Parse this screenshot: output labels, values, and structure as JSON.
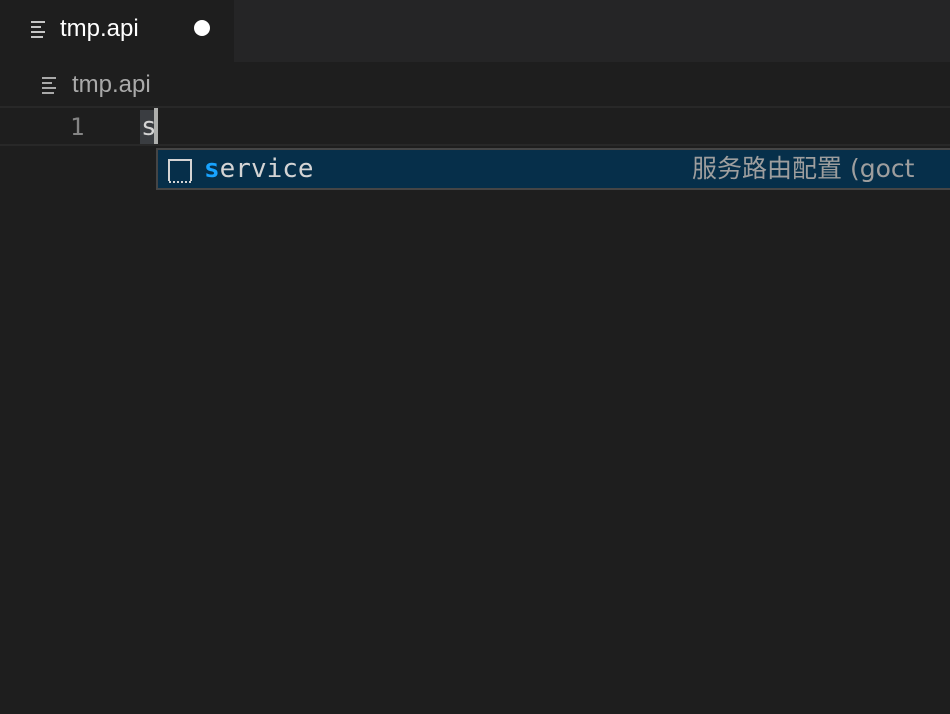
{
  "tab": {
    "title": "tmp.api",
    "icon": "lines-icon",
    "dirty": true
  },
  "breadcrumb": {
    "label": "tmp.api",
    "icon": "lines-icon"
  },
  "editor": {
    "line_number": "1",
    "text": "s"
  },
  "suggest": {
    "items": [
      {
        "match": "s",
        "rest": "ervice",
        "detail": "服务路由配置 (goct",
        "kind_icon": "snippet-icon"
      }
    ]
  },
  "colors": {
    "background": "#1e1e1e",
    "tabbar": "#252526",
    "suggest_selected": "#062f4a",
    "match_highlight": "#18a3ff"
  }
}
